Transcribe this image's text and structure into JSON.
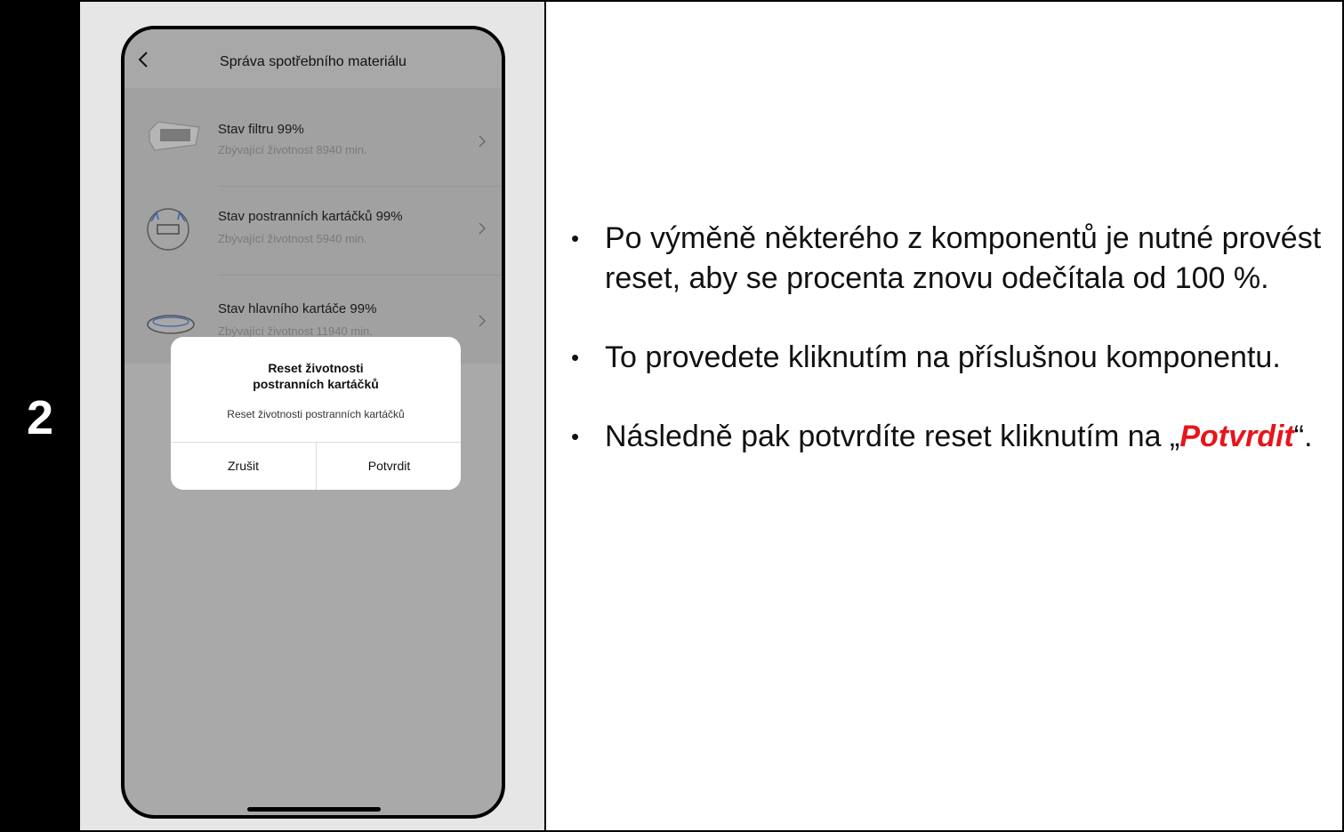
{
  "step_number": "2",
  "phone": {
    "header_title": "Správa spotřebního materiálu",
    "items": [
      {
        "title": "Stav filtru 99%",
        "subtitle": "Zbývající životnost 8940 min."
      },
      {
        "title": "Stav postranních kartáčků 99%",
        "subtitle": "Zbývající životnost 5940 min."
      },
      {
        "title": "Stav hlavního kartáče 99%",
        "subtitle": "Zbývající životnost 11940 min."
      }
    ],
    "dialog": {
      "title_line1": "Reset životnosti",
      "title_line2": "postranních kartáčků",
      "message": "Reset životnosti postranních kartáčků",
      "cancel": "Zrušit",
      "confirm": "Potvrdit"
    }
  },
  "instructions": {
    "bullet_char": "•",
    "b1": "Po výměně některého z komponentů je nutné provést reset, aby se procenta znovu odečítala od 100 %.",
    "b2": "To provedete kliknutím na příslušnou komponentu.",
    "b3_prefix": "Následně pak potvrdíte reset kliknutím na „",
    "b3_highlight": "Potvrdit",
    "b3_suffix": "“."
  },
  "colors": {
    "highlight": "#e8141b",
    "step_background": "#000000",
    "panel_background": "#e6e6e6"
  }
}
